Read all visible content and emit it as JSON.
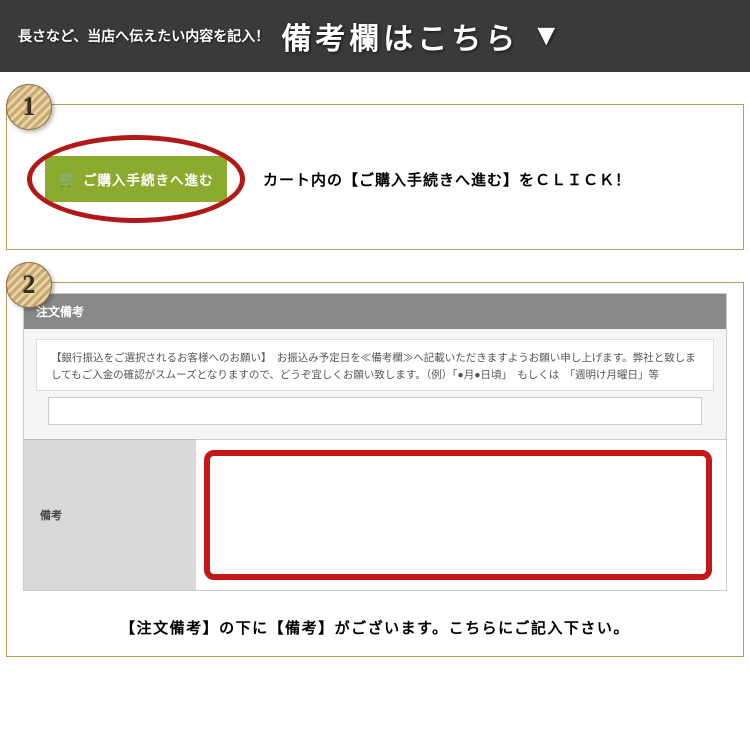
{
  "header": {
    "subtitle": "長さなど、当店へ伝えたい内容を記入！",
    "title": "備考欄はこちら",
    "triangle": "▼"
  },
  "step1": {
    "number": "1",
    "button_label": "ご購入手続きへ進む",
    "instruction": "カート内の【ご購入手続きへ進む】をＣＬＩＣＫ！"
  },
  "step2": {
    "number": "2",
    "form_header": "注文備考",
    "notice_text": "【銀行振込をご選択されるお客様へのお願い】　お振込み予定日を≪備考欄≫へ記載いただきますようお願い申し上げます。弊社と致しましてもご入金の確認がスムーズとなりますので、どうぞ宜しくお願い致します。（例）「●月●日頃」　もしくは　「週明け月曜日」等",
    "textarea_label": "備考",
    "caption": "【注文備考】の下に【備考】がございます。こちらにご記入下さい。"
  }
}
